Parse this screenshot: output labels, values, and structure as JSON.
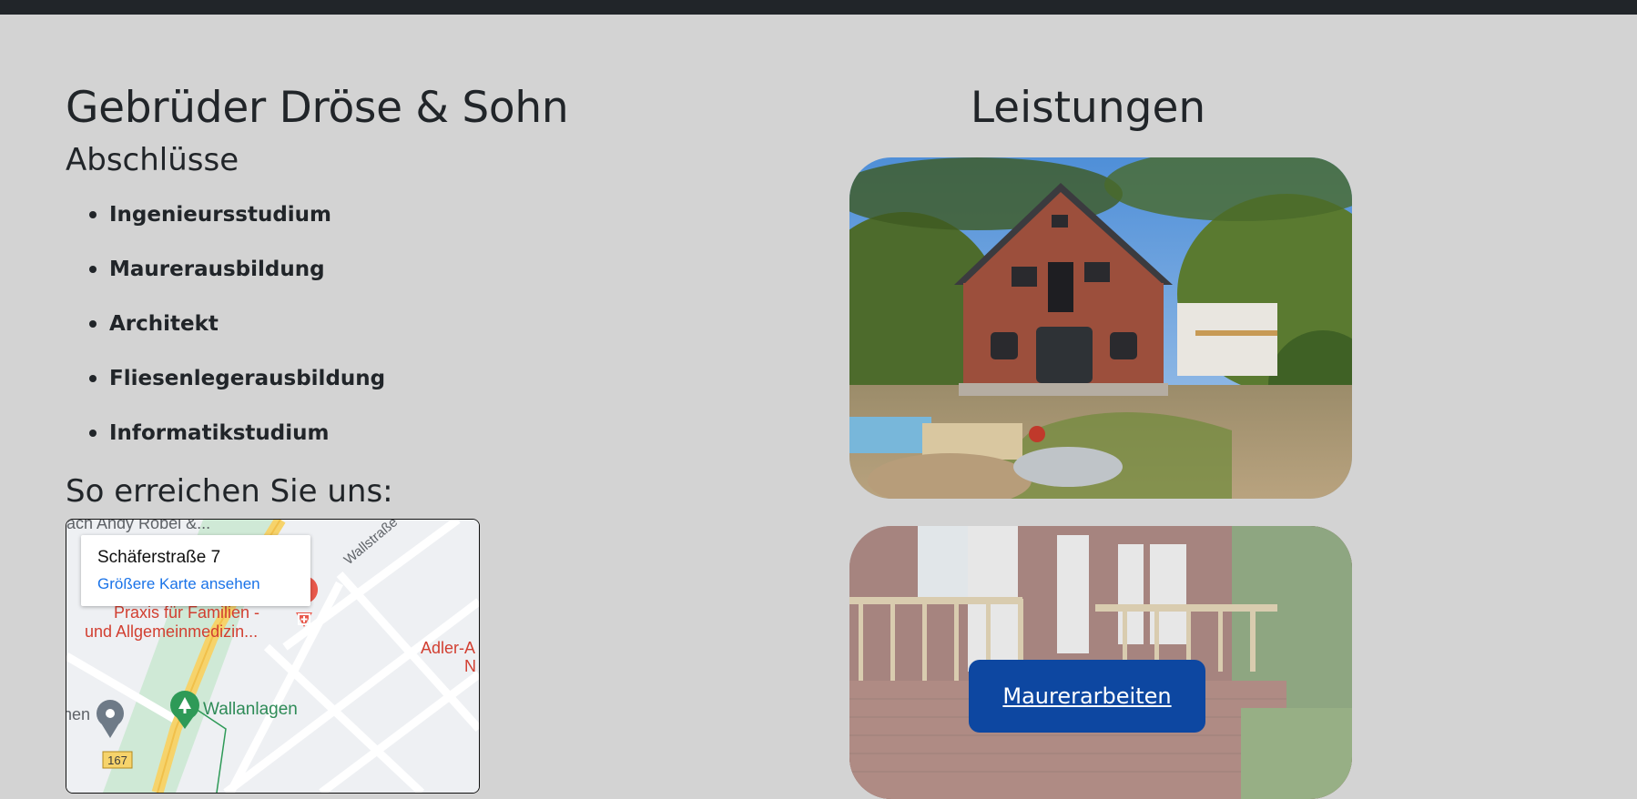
{
  "company": {
    "name": "Gebrüder Dröse & Sohn"
  },
  "degrees": {
    "heading": "Abschlüsse",
    "items": [
      "Ingenieursstudium",
      "Maurerausbildung",
      "Architekt",
      "Fliesenlegerausbildung",
      "Informatikstudium"
    ]
  },
  "reach": {
    "heading": "So erreichen Sie uns:",
    "map": {
      "address": "Schäferstraße 7",
      "link": "Größere Karte ansehen",
      "poi_top": "ach Andy Röbel &...",
      "street": "Wallstraße",
      "praxis": [
        "Praxis für Familien -",
        "und Allgemeinmedizin..."
      ],
      "adler": [
        "Adler-A",
        "N"
      ],
      "park": "Wallanlagen",
      "left_label": "hen",
      "route": "167"
    }
  },
  "services": {
    "heading": "Leistungen",
    "button": "Maurerarbeiten"
  }
}
